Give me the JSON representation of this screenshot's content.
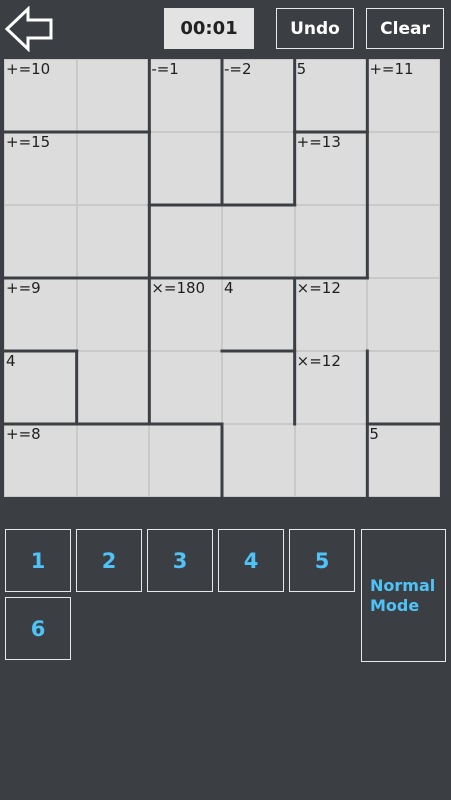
{
  "header": {
    "back_icon": "arrow-left-icon",
    "timer": "00:01",
    "undo_label": "Undo",
    "clear_label": "Clear"
  },
  "board": {
    "size": 6,
    "clues": [
      {
        "row": 0,
        "col": 0,
        "text": "+=10"
      },
      {
        "row": 0,
        "col": 2,
        "text": "-=1"
      },
      {
        "row": 0,
        "col": 3,
        "text": "-=2"
      },
      {
        "row": 0,
        "col": 4,
        "text": "5"
      },
      {
        "row": 0,
        "col": 5,
        "text": "+=11"
      },
      {
        "row": 1,
        "col": 0,
        "text": "+=15"
      },
      {
        "row": 1,
        "col": 4,
        "text": "+=13"
      },
      {
        "row": 3,
        "col": 0,
        "text": "+=9"
      },
      {
        "row": 3,
        "col": 2,
        "text": "×=180"
      },
      {
        "row": 3,
        "col": 3,
        "text": "4"
      },
      {
        "row": 3,
        "col": 4,
        "text": "×=12"
      },
      {
        "row": 4,
        "col": 0,
        "text": "4"
      },
      {
        "row": 4,
        "col": 4,
        "text": "×=12"
      },
      {
        "row": 5,
        "col": 0,
        "text": "+=8"
      },
      {
        "row": 5,
        "col": 5,
        "text": "5"
      }
    ]
  },
  "keypad": {
    "numbers": [
      "1",
      "2",
      "3",
      "4",
      "5",
      "6"
    ],
    "mode_label": "Normal\nMode"
  },
  "colors": {
    "background": "#3b3f44",
    "cell": "#dcdcdc",
    "accent": "#4fc3f7"
  }
}
